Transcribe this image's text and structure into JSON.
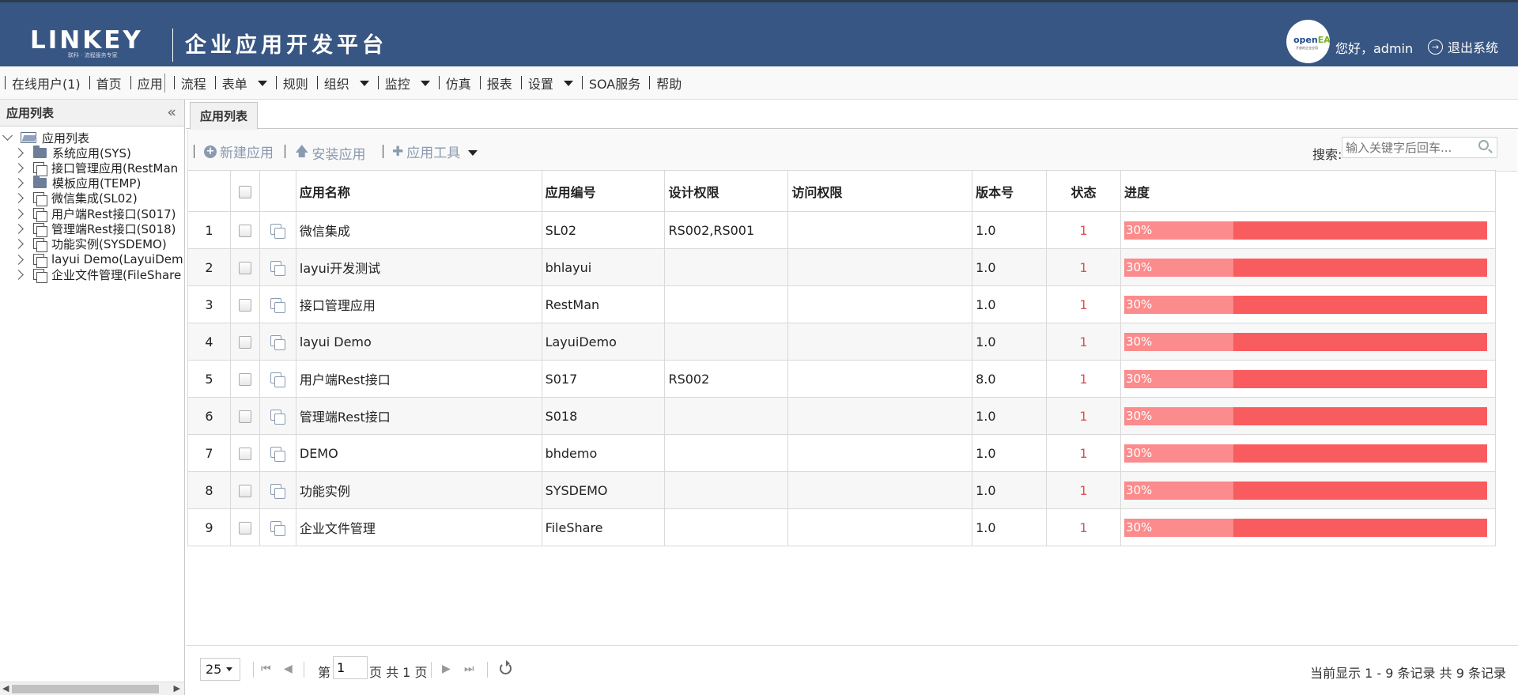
{
  "header": {
    "logo_text": "LINKEY",
    "logo_sub": "联科 · 流程服务专家",
    "platform_title": "企业应用开发平台",
    "avatar_text1": "open",
    "avatar_text1b": "EA",
    "avatar_text2": "开放的企业应用",
    "greeting": "您好，admin",
    "logout": "退出系统"
  },
  "menu": [
    {
      "label": "在线用户(1)",
      "dropdown": false
    },
    {
      "label": "首页",
      "dropdown": false
    },
    {
      "label": "应用",
      "dropdown": false,
      "active": true
    },
    {
      "label": "流程",
      "dropdown": false
    },
    {
      "label": "表单",
      "dropdown": true
    },
    {
      "label": "规则",
      "dropdown": false
    },
    {
      "label": "组织",
      "dropdown": true
    },
    {
      "label": "监控",
      "dropdown": true
    },
    {
      "label": "仿真",
      "dropdown": false
    },
    {
      "label": "报表",
      "dropdown": false
    },
    {
      "label": "设置",
      "dropdown": true
    },
    {
      "label": "SOA服务",
      "dropdown": false
    },
    {
      "label": "帮助",
      "dropdown": false
    }
  ],
  "sidebar": {
    "title": "应用列表",
    "collapse_icon": "double-chevron-left-icon",
    "tree_root": "应用列表",
    "items": [
      {
        "label": "系统应用(SYS)",
        "icon": "folder-icon"
      },
      {
        "label": "接口管理应用(RestMan",
        "icon": "doc-icon"
      },
      {
        "label": "模板应用(TEMP)",
        "icon": "folder-icon"
      },
      {
        "label": "微信集成(SL02)",
        "icon": "doc-icon"
      },
      {
        "label": "用户端Rest接口(S017)",
        "icon": "doc-icon"
      },
      {
        "label": "管理端Rest接口(S018)",
        "icon": "doc-icon"
      },
      {
        "label": "功能实例(SYSDEMO)",
        "icon": "doc-icon"
      },
      {
        "label": "layui Demo(LayuiDem",
        "icon": "doc-icon"
      },
      {
        "label": "企业文件管理(FileShare",
        "icon": "doc-icon"
      }
    ]
  },
  "tab": {
    "label": "应用列表"
  },
  "toolbar": {
    "new_app": "新建应用",
    "install_app": "安装应用",
    "app_tools": "应用工具",
    "search_label": "搜索:",
    "search_placeholder": "输入关键字后回车..."
  },
  "table": {
    "columns": [
      "",
      "",
      "",
      "应用名称",
      "应用编号",
      "设计权限",
      "访问权限",
      "版本号",
      "状态",
      "进度"
    ],
    "rows": [
      {
        "no": "1",
        "name": "微信集成",
        "code": "SL02",
        "design": "RS002,RS001",
        "access": "",
        "version": "1.0",
        "status": "1",
        "progress_label": "30%",
        "progress": 0.3
      },
      {
        "no": "2",
        "name": "layui开发测试",
        "code": "bhlayui",
        "design": "",
        "access": "",
        "version": "1.0",
        "status": "1",
        "progress_label": "30%",
        "progress": 0.3
      },
      {
        "no": "3",
        "name": "接口管理应用",
        "code": "RestMan",
        "design": "",
        "access": "",
        "version": "1.0",
        "status": "1",
        "progress_label": "30%",
        "progress": 0.3
      },
      {
        "no": "4",
        "name": "layui Demo",
        "code": "LayuiDemo",
        "design": "",
        "access": "",
        "version": "1.0",
        "status": "1",
        "progress_label": "30%",
        "progress": 0.3
      },
      {
        "no": "5",
        "name": "用户端Rest接口",
        "code": "S017",
        "design": "RS002",
        "access": "",
        "version": "8.0",
        "status": "1",
        "progress_label": "30%",
        "progress": 0.3
      },
      {
        "no": "6",
        "name": "管理端Rest接口",
        "code": "S018",
        "design": "",
        "access": "",
        "version": "1.0",
        "status": "1",
        "progress_label": "30%",
        "progress": 0.3
      },
      {
        "no": "7",
        "name": "DEMO",
        "code": "bhdemo",
        "design": "",
        "access": "",
        "version": "1.0",
        "status": "1",
        "progress_label": "30%",
        "progress": 0.3
      },
      {
        "no": "8",
        "name": "功能实例",
        "code": "SYSDEMO",
        "design": "",
        "access": "",
        "version": "1.0",
        "status": "1",
        "progress_label": "30%",
        "progress": 0.3
      },
      {
        "no": "9",
        "name": "企业文件管理",
        "code": "FileShare",
        "design": "",
        "access": "",
        "version": "1.0",
        "status": "1",
        "progress_label": "30%",
        "progress": 0.3
      }
    ]
  },
  "pager": {
    "page_size": "25",
    "page_prefix": "第",
    "page_value": "1",
    "page_suffix": "页 共 1 页",
    "info": "当前显示 1 - 9 条记录 共 9 条记录"
  },
  "colors": {
    "header_bg": "#385683",
    "progress_bar": "#f95c5f",
    "progress_fill": "#fb8b8c",
    "status_text": "#e05050"
  }
}
